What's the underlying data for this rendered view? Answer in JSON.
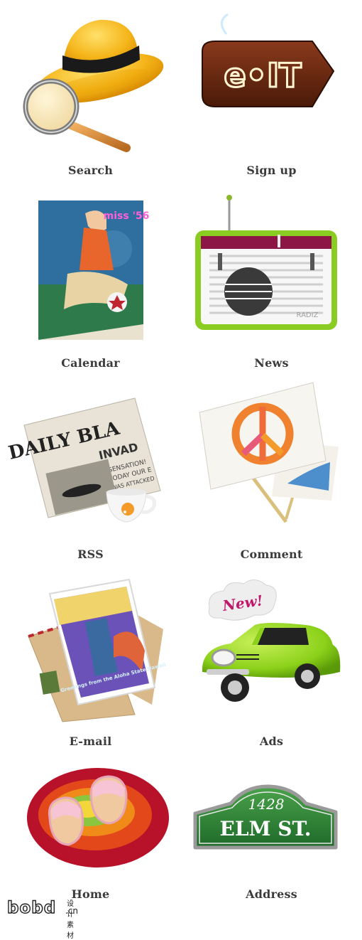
{
  "icons": [
    {
      "id": "search",
      "label": "Search",
      "icon_name": "hat-magnifier-icon"
    },
    {
      "id": "signup",
      "label": "Sign up",
      "icon_name": "neon-sign-icon"
    },
    {
      "id": "calendar",
      "label": "Calendar",
      "icon_name": "pinup-calendar-icon"
    },
    {
      "id": "news",
      "label": "News",
      "icon_name": "radio-icon"
    },
    {
      "id": "rss",
      "label": "RSS",
      "icon_name": "newspaper-cup-icon"
    },
    {
      "id": "comment",
      "label": "Comment",
      "icon_name": "peace-sign-board-icon"
    },
    {
      "id": "email",
      "label": "E-mail",
      "icon_name": "postcard-envelope-icon"
    },
    {
      "id": "ads",
      "label": "Ads",
      "icon_name": "green-car-icon"
    },
    {
      "id": "home",
      "label": "Home",
      "icon_name": "slippers-rug-icon"
    },
    {
      "id": "address",
      "label": "Address",
      "icon_name": "street-sign-icon"
    }
  ],
  "art_text": {
    "signup_neon": "e•IT",
    "calendar_stamp": "miss '56",
    "news_brand": "RADIZ",
    "newspaper_masthead": "DAILY BLA",
    "newspaper_headline": "INVAD",
    "newspaper_lines": [
      "SENSATION!",
      "TODAY OUR E",
      "WAS ATTACKED"
    ],
    "postcard_text": "Greetings from the Aloha State Hawaii",
    "ads_bubble": "New!",
    "street_number": "1428",
    "street_name": "ELM ST."
  },
  "watermark": {
    "brand": "bobd",
    "domain": ".cn",
    "sub": "设计素材"
  }
}
